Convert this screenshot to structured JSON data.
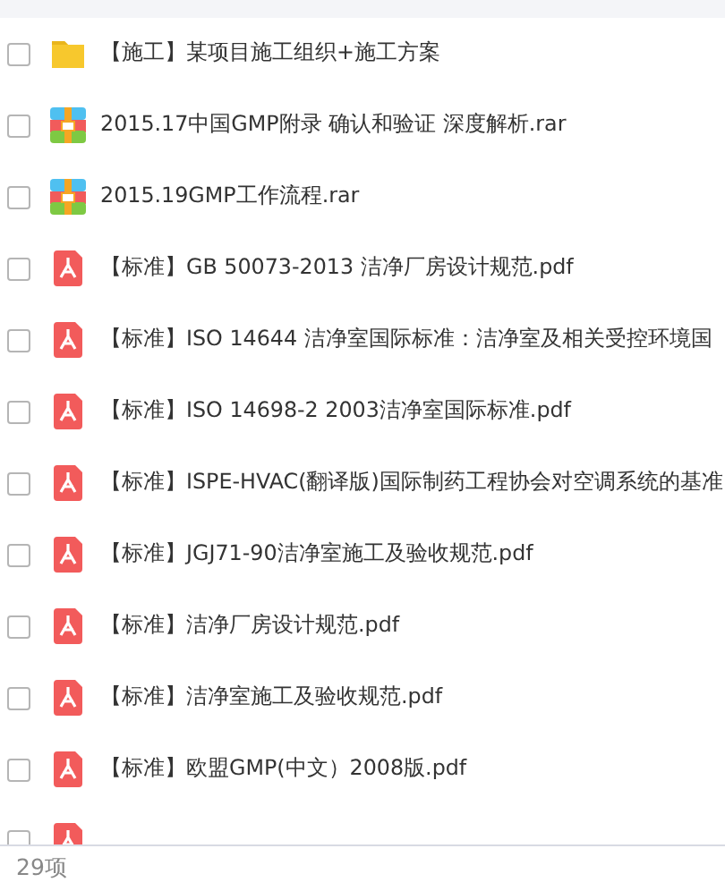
{
  "files": [
    {
      "kind": "folder",
      "name": "【施工】某项目施工组织+施工方案",
      "checked": false
    },
    {
      "kind": "archive",
      "name": "2015.17中国GMP附录 确认和验证 深度解析.rar",
      "checked": false
    },
    {
      "kind": "archive",
      "name": "2015.19GMP工作流程.rar",
      "checked": false
    },
    {
      "kind": "pdf",
      "name": "【标准】GB 50073-2013 洁净厂房设计规范.pdf",
      "checked": false
    },
    {
      "kind": "pdf",
      "name": "【标准】ISO 14644 洁净室国际标准：洁净室及相关受控环境国",
      "checked": false
    },
    {
      "kind": "pdf",
      "name": "【标准】ISO 14698-2 2003洁净室国际标准.pdf",
      "checked": false
    },
    {
      "kind": "pdf",
      "name": "【标准】ISPE-HVAC(翻译版)国际制药工程协会对空调系统的基准",
      "checked": false
    },
    {
      "kind": "pdf",
      "name": "【标准】JGJ71-90洁净室施工及验收规范.pdf",
      "checked": false
    },
    {
      "kind": "pdf",
      "name": "【标准】洁净厂房设计规范.pdf",
      "checked": false
    },
    {
      "kind": "pdf",
      "name": "【标准】洁净室施工及验收规范.pdf",
      "checked": false
    },
    {
      "kind": "pdf",
      "name": "【标准】欧盟GMP(中文）2008版.pdf",
      "checked": false
    },
    {
      "kind": "pdf",
      "checked": false
    }
  ],
  "status_bar": {
    "count": "29项"
  }
}
